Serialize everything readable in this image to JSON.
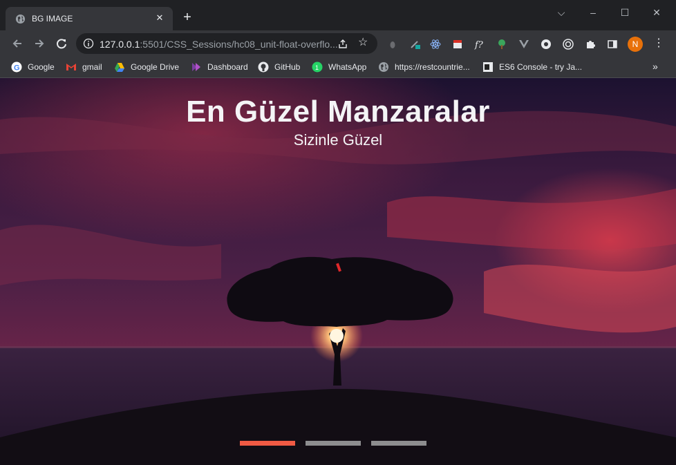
{
  "browser": {
    "tab": {
      "title": "BG IMAGE"
    },
    "address": {
      "host": "127.0.0.1",
      "rest": ":5501/CSS_Sessions/hc08_unit-float-overflo..."
    },
    "profile_initial": "N"
  },
  "bookmarks": [
    {
      "label": "Google",
      "icon": "google-icon"
    },
    {
      "label": "gmail",
      "icon": "gmail-icon"
    },
    {
      "label": "Google Drive",
      "icon": "google-drive-icon"
    },
    {
      "label": "Dashboard",
      "icon": "dashboard-icon"
    },
    {
      "label": "GitHub",
      "icon": "github-icon"
    },
    {
      "label": "WhatsApp",
      "icon": "whatsapp-icon"
    },
    {
      "label": "https://restcountrie...",
      "icon": "globe-icon"
    },
    {
      "label": "ES6 Console - try Ja...",
      "icon": "es6-icon"
    }
  ],
  "page": {
    "title": "En Güzel Manzaralar",
    "subtitle": "Sizinle Güzel",
    "slider": {
      "count": 3,
      "active_index": 0
    }
  },
  "colors": {
    "dot_active": "#f05a44",
    "dot_inactive": "#8d8d8f"
  }
}
